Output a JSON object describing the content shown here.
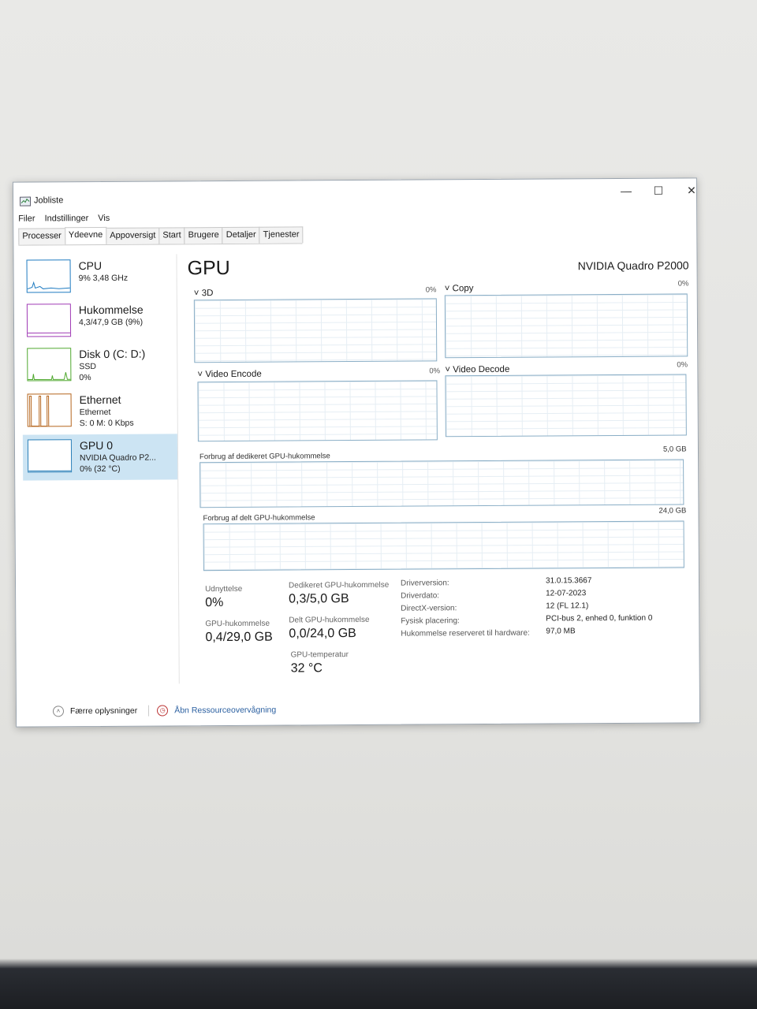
{
  "window": {
    "title": "Jobliste",
    "minimize": "—",
    "maximize": "☐",
    "close": "✕"
  },
  "menu": [
    "Filer",
    "Indstillinger",
    "Vis"
  ],
  "tabs": [
    "Processer",
    "Ydeevne",
    "Appoversigt",
    "Start",
    "Brugere",
    "Detaljer",
    "Tjenester"
  ],
  "active_tab": "Ydeevne",
  "sidebar": [
    {
      "name": "CPU",
      "sub1": "9% 3,48 GHz",
      "sub2": "",
      "color": "#1f7bc1"
    },
    {
      "name": "Hukommelse",
      "sub1": "4,3/47,9 GB (9%)",
      "sub2": "",
      "color": "#a03bb5"
    },
    {
      "name": "Disk 0 (C: D:)",
      "sub1": "SSD",
      "sub2": "0%",
      "color": "#4fa82e"
    },
    {
      "name": "Ethernet",
      "sub1": "Ethernet",
      "sub2": "S: 0 M: 0 Kbps",
      "color": "#b5651d"
    },
    {
      "name": "GPU 0",
      "sub1": "NVIDIA Quadro P2...",
      "sub2": "0% (32 °C)",
      "color": "#2a7fb8"
    }
  ],
  "gpu": {
    "title": "GPU",
    "model": "NVIDIA Quadro P2000",
    "engines": [
      {
        "label": "3D",
        "percent": "0%"
      },
      {
        "label": "Copy",
        "percent": "0%"
      },
      {
        "label": "Video Encode",
        "percent": "0%"
      },
      {
        "label": "Video Decode",
        "percent": "0%"
      }
    ],
    "dedicated_label": "Forbrug af dedikeret GPU-hukommelse",
    "dedicated_max": "5,0 GB",
    "shared_label": "Forbrug af delt GPU-hukommelse",
    "shared_max": "24,0 GB",
    "stats": {
      "utilization_label": "Udnyttelse",
      "utilization": "0%",
      "dedicated_label": "Dedikeret GPU-hukommelse",
      "dedicated": "0,3/5,0 GB",
      "gpu_mem_label": "GPU-hukommelse",
      "gpu_mem": "0,4/29,0 GB",
      "shared_label": "Delt GPU-hukommelse",
      "shared": "0,0/24,0 GB",
      "temp_label": "GPU-temperatur",
      "temp": "32 °C"
    },
    "details": [
      {
        "label": "Driverversion:",
        "value": "31.0.15.3667"
      },
      {
        "label": "Driverdato:",
        "value": "12-07-2023"
      },
      {
        "label": "DirectX-version:",
        "value": "12 (FL 12.1)"
      },
      {
        "label": "Fysisk placering:",
        "value": "PCI-bus 2, enhed 0, funktion 0"
      },
      {
        "label": "Hukommelse reserveret til hardware:",
        "value": "97,0 MB"
      }
    ]
  },
  "footer": {
    "less_details": "Færre oplysninger",
    "resource_monitor": "Åbn Ressourceovervågning"
  }
}
